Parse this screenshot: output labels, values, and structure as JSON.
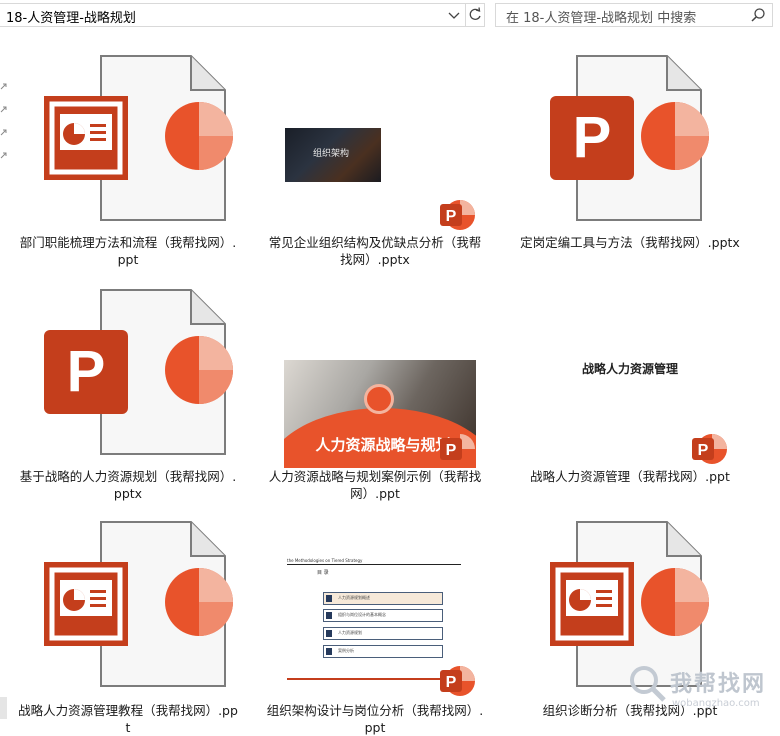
{
  "address_bar": {
    "path": "18-人资管理-战略规划"
  },
  "search_box": {
    "placeholder": "在 18-人资管理-战略规划 中搜索"
  },
  "files": [
    {
      "name": "部门职能梳理方法和流程（我帮找网）.ppt",
      "thumb": "ppt-legacy-icon"
    },
    {
      "name": "常见企业组织结构及优缺点分析（我帮找网）.pptx",
      "thumb": "slide-preview",
      "preview_text": "组织架构"
    },
    {
      "name": "定岗定编工具与方法（我帮找网）.pptx",
      "thumb": "pptx-icon"
    },
    {
      "name": "基于战略的人力资源规划（我帮找网）.pptx",
      "thumb": "pptx-icon"
    },
    {
      "name": "人力资源战略与规划案例示例（我帮找网）.ppt",
      "thumb": "slide-preview",
      "preview_text": "人力资源战略与规划"
    },
    {
      "name": "战略人力资源管理（我帮找网）.ppt",
      "thumb": "slide-preview",
      "preview_text": "战略人力资源管理"
    },
    {
      "name": "战略人力资源管理教程（我帮找网）.ppt",
      "thumb": "ppt-legacy-icon"
    },
    {
      "name": "组织架构设计与岗位分析（我帮找网）.ppt",
      "thumb": "slide-preview",
      "preview_text": "the Methodologies on Tiered Strategy"
    },
    {
      "name": "组织诊断分析（我帮找网）.ppt",
      "thumb": "ppt-legacy-icon"
    }
  ],
  "toc_preview": {
    "head": "the Methodologies on Tiered Strategy",
    "mu": "目 录",
    "rows": [
      "人力资源规划概述",
      "组织与岗位设计的基本概念",
      "人力资源规划",
      "案例分析"
    ]
  },
  "watermark": {
    "text": "我帮找网",
    "sub": "wobangzhao.com"
  },
  "colors": {
    "ppt_red": "#c43e1c",
    "ppt_orange": "#e8532b",
    "ppt_light": "#f3b49f"
  }
}
